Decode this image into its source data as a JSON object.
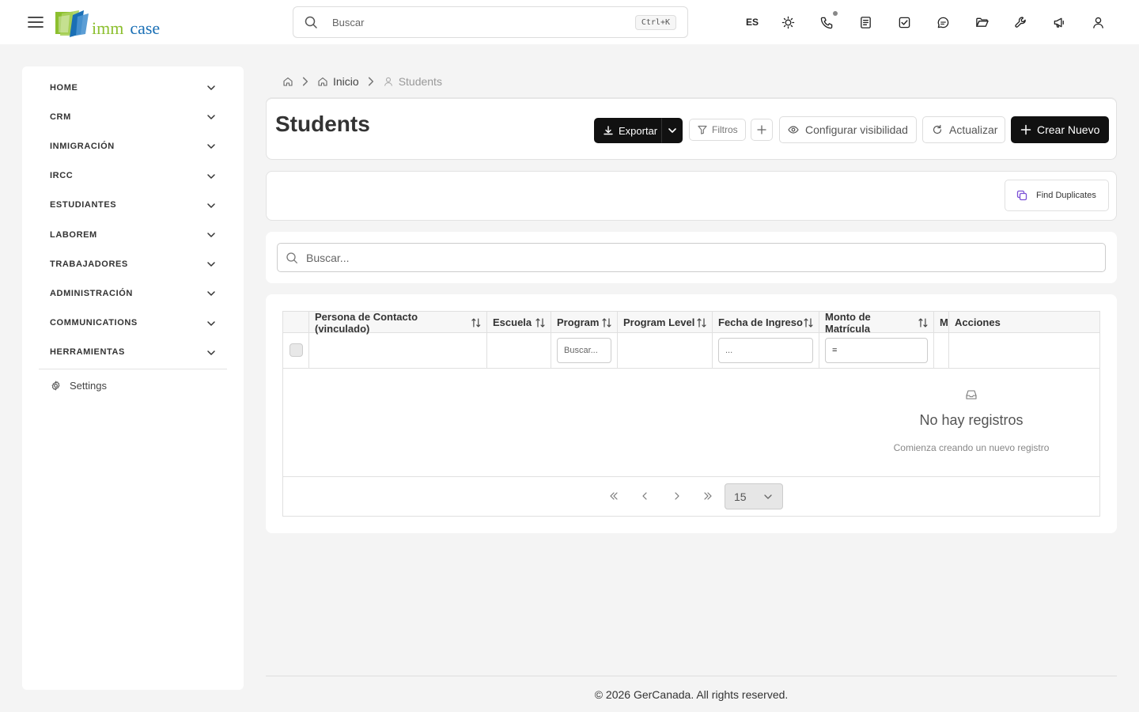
{
  "header": {
    "logo_text_1": "imm",
    "logo_text_2": "case",
    "search_placeholder": "Buscar",
    "search_shortcut": "Ctrl+K",
    "language": "ES",
    "icons": [
      "sun-icon",
      "phone-icon",
      "notes-icon",
      "tasks-icon",
      "chat-icon",
      "folder-icon",
      "wrench-icon",
      "megaphone-icon",
      "user-icon"
    ]
  },
  "sidebar": {
    "items": [
      {
        "label": "HOME"
      },
      {
        "label": "CRM"
      },
      {
        "label": "INMIGRACIÓN"
      },
      {
        "label": "IRCC"
      },
      {
        "label": "ESTUDIANTES"
      },
      {
        "label": "LABOREM"
      },
      {
        "label": "TRABAJADORES"
      },
      {
        "label": "ADMINISTRACIÓN"
      },
      {
        "label": "COMMUNICATIONS"
      },
      {
        "label": "HERRAMIENTAS"
      }
    ],
    "settings_label": "Settings"
  },
  "breadcrumb": {
    "home_label": "Inicio",
    "current_label": "Students"
  },
  "page": {
    "title": "Students",
    "export_label": "Exportar",
    "filters_label": "Filtros",
    "visibility_label": "Configurar visibilidad",
    "refresh_label": "Actualizar",
    "create_label": "Crear Nuevo",
    "find_duplicates_label": "Find Duplicates"
  },
  "table": {
    "search_placeholder": "Buscar...",
    "columns": [
      "Persona de Contacto (vinculado)",
      "Escuela",
      "Program",
      "Program Level",
      "Fecha de Ingreso",
      "Monto de Matrícula",
      "M",
      "Acciones"
    ],
    "filters": {
      "program_placeholder": "Buscar...",
      "fecha_placeholder": "...",
      "monto_value": "="
    },
    "empty_title": "No hay registros",
    "empty_subtitle": "Comienza creando un nuevo registro",
    "page_size": "15"
  },
  "footer": {
    "text": "© 2026 GerCanada. All rights reserved."
  },
  "colors": {
    "accent_dark": "#111111",
    "logo_green": "#8cbf2f",
    "logo_blue": "#1a6fb5",
    "duplicate_icon": "#7b4fd6"
  }
}
